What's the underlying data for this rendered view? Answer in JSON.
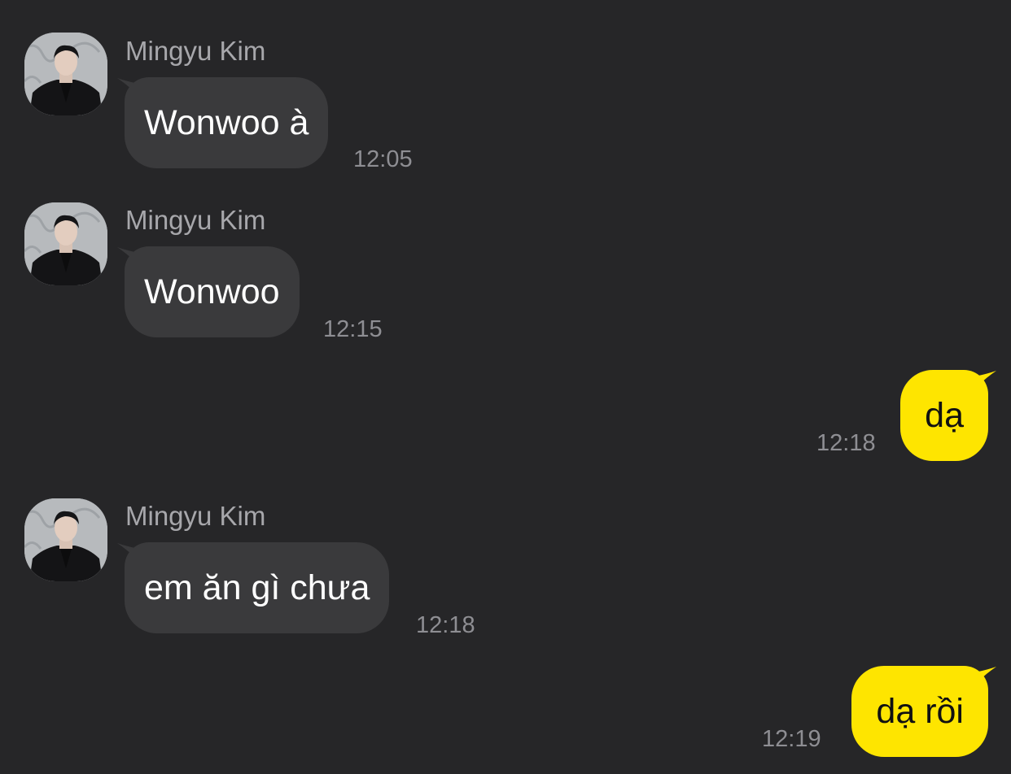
{
  "colors": {
    "background": "#262628",
    "incoming_bubble": "#3a3a3c",
    "outgoing_bubble": "#fee500",
    "sender_name": "#a7a7ab",
    "timestamp": "#8e8e93"
  },
  "messages": [
    {
      "direction": "incoming",
      "sender": "Mingyu Kim",
      "text": "Wonwoo à",
      "time": "12:05"
    },
    {
      "direction": "incoming",
      "sender": "Mingyu Kim",
      "text": "Wonwoo",
      "time": "12:15"
    },
    {
      "direction": "outgoing",
      "text": "dạ",
      "time": "12:18"
    },
    {
      "direction": "incoming",
      "sender": "Mingyu Kim",
      "text": "em ăn gì chưa",
      "time": "12:18"
    },
    {
      "direction": "outgoing",
      "text": "dạ rồi",
      "time": "12:19"
    }
  ]
}
